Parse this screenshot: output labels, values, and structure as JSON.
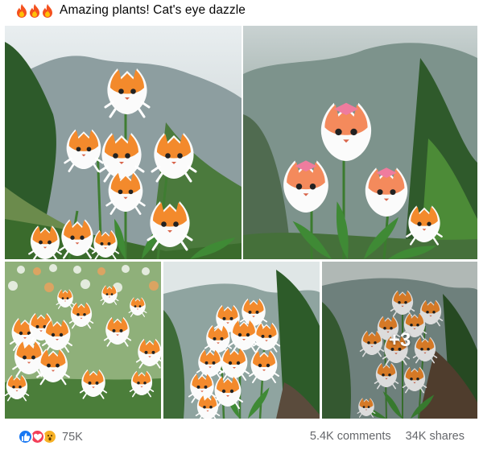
{
  "post": {
    "title": "Amazing plants! Cat's eye dazzle",
    "title_icons": [
      "fire-icon",
      "fire-icon",
      "fire-icon"
    ]
  },
  "gallery": {
    "more_count": "+3"
  },
  "footer": {
    "reaction_icons": [
      "like-icon",
      "love-icon",
      "wow-icon"
    ],
    "reaction_count": "75K",
    "comments": "5.4K comments",
    "shares": "34K shares"
  },
  "colors": {
    "like": "#1877f2",
    "love": "#f33e58",
    "wow": "#f7b125",
    "meta_text": "#65676b"
  }
}
